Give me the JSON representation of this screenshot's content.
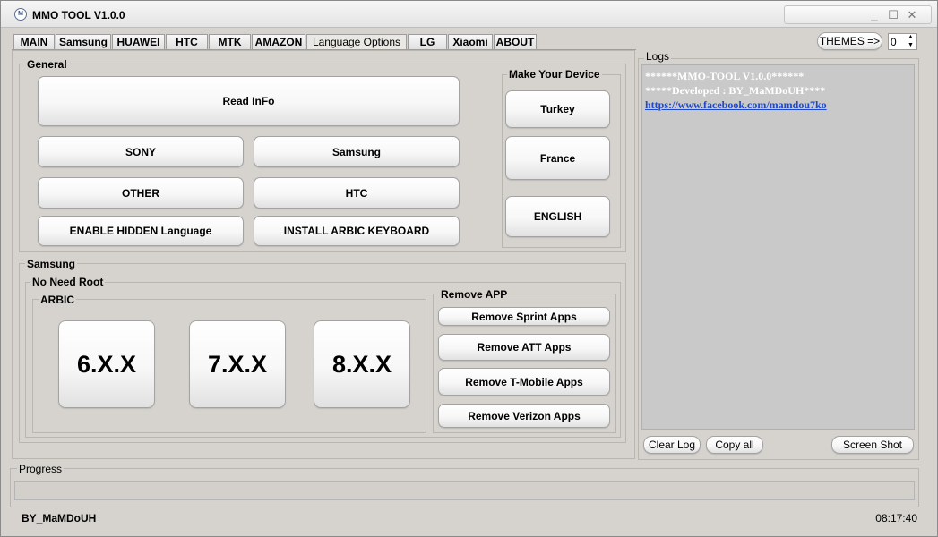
{
  "window": {
    "title": "MMO TOOL V1.0.0"
  },
  "tabs": [
    "MAIN",
    "Samsung",
    "HUAWEI",
    "HTC",
    "MTK",
    "AMAZON",
    "Language Options",
    "LG",
    "Xiaomi",
    "ABOUT"
  ],
  "themes": {
    "button_label": "THEMES =>",
    "spinner_value": "0"
  },
  "general": {
    "label": "General",
    "read_info": "Read InFo",
    "sony": "SONY",
    "samsung": "Samsung",
    "other": "OTHER",
    "htc": "HTC",
    "enable_hidden": "ENABLE HIDDEN Language",
    "install_arabic_keyboard": "INSTALL ARBIC KEYBOARD"
  },
  "make_device": {
    "label": "Make Your Device",
    "turkey": "Turkey",
    "france": "France",
    "english": "ENGLISH"
  },
  "samsung": {
    "label": "Samsung",
    "no_root_label": "No Need Root",
    "arabic_label": "ARBIC",
    "v6": "6.X.X",
    "v7": "7.X.X",
    "v8": "8.X.X"
  },
  "remove_app": {
    "label": "Remove APP",
    "sprint": "Remove Sprint Apps",
    "att": "Remove ATT Apps",
    "tmobile": "Remove T-Mobile Apps",
    "verizon": "Remove Verizon Apps"
  },
  "logs": {
    "label": "Logs",
    "line1": "******MMO-TOOL V1.0.0******",
    "line2": "*****Developed : BY_MaMDoUH****",
    "link": "https://www.facebook.com/mamdou7ko",
    "clear": "Clear Log",
    "copy": "Copy all",
    "screenshot": "Screen Shot"
  },
  "progress": {
    "label": "Progress",
    "value": 0
  },
  "status": {
    "author": "BY_MaMDoUH",
    "time": "08:17:40"
  }
}
